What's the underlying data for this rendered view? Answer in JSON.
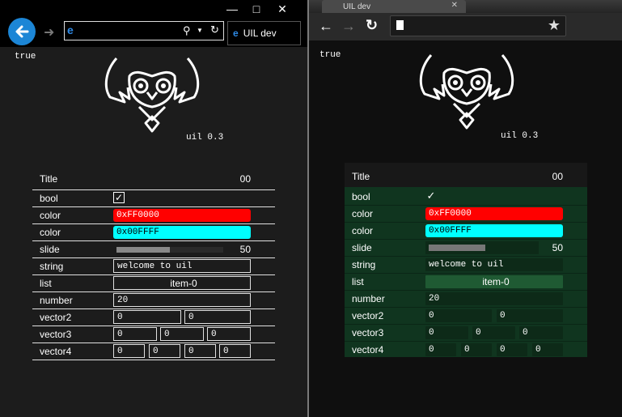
{
  "left_browser": {
    "tab_title": "UIL dev",
    "status_text": "true",
    "version_text": "uil 0.3"
  },
  "right_browser": {
    "tab_title": "UIL dev",
    "status_text": "true",
    "version_text": "uil 0.3"
  },
  "panel": {
    "title": "Title",
    "title_value": "00",
    "bool_label": "bool",
    "bool_checked": true,
    "color1_label": "color",
    "color1_value": "0xFF0000",
    "color1_hex": "#ff0000",
    "color2_label": "color",
    "color2_value": "0x00FFFF",
    "color2_hex": "#00ffff",
    "slide_label": "slide",
    "slide_value": "50",
    "slide_fraction": 0.5,
    "string_label": "string",
    "string_value": "welcome to uil",
    "list_label": "list",
    "list_value": "item-0",
    "number_label": "number",
    "number_value": "20",
    "vector2_label": "vector2",
    "vector2_values": [
      "0",
      "0"
    ],
    "vector3_label": "vector3",
    "vector3_values": [
      "0",
      "0",
      "0"
    ],
    "vector4_label": "vector4",
    "vector4_values": [
      "0",
      "0",
      "0",
      "0"
    ]
  },
  "colors": {
    "ie_accent": "#1c86d6",
    "chrome_panel": "#10351f"
  }
}
